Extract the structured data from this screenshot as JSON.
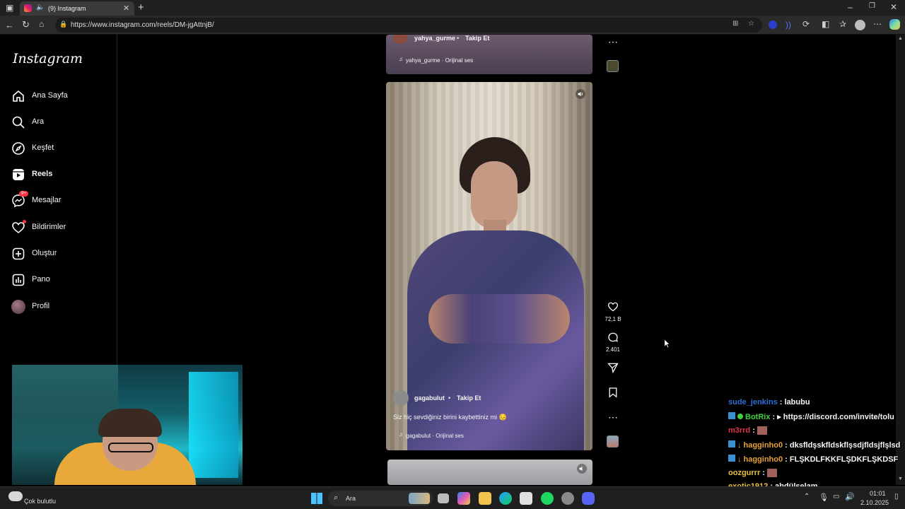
{
  "browser": {
    "tab_title": "(9) Instagram",
    "new_tab": "+",
    "url": "https://www.instagram.com/reels/DM-jgAttnjB/"
  },
  "instagram": {
    "logo": "Instagram",
    "nav": [
      {
        "label": "Ana Sayfa",
        "icon": "home-icon"
      },
      {
        "label": "Ara",
        "icon": "search-icon"
      },
      {
        "label": "Keşfet",
        "icon": "compass-icon"
      },
      {
        "label": "Reels",
        "icon": "reels-icon"
      },
      {
        "label": "Mesajlar",
        "icon": "messenger-icon",
        "badge": "9+"
      },
      {
        "label": "Bildirimler",
        "icon": "heart-icon"
      },
      {
        "label": "Oluştur",
        "icon": "plus-square-icon"
      },
      {
        "label": "Pano",
        "icon": "dashboard-icon"
      },
      {
        "label": "Profil",
        "icon": "avatar-icon"
      }
    ],
    "reel_top": {
      "username": "yahya_gurme",
      "follow": "Takip Et",
      "audio": "yahya_gurme · Orijinal ses"
    },
    "reel_main": {
      "username": "gagabulut",
      "follow": "Takip Et",
      "caption": "Siz hiç sevdiğiniz birini kaybettiniz mi 😔",
      "audio": "gagabulut · Orijinal ses",
      "likes": "72,1 B",
      "comments": "2.401"
    }
  },
  "chat": [
    {
      "user": "sude_jenkins",
      "msg": "labubu",
      "color": "#2f6fd6"
    },
    {
      "user": "BotRix",
      "msg": "▸ https://discord.com/invite/tolu",
      "color": "#3fd23f"
    },
    {
      "user": "m3rrd",
      "msg": "",
      "color": "#e0334a"
    },
    {
      "user": "hagginho0",
      "msg": "dksfldşskfldskflşsdjfldsjflşlsd",
      "color": "#e6a23a"
    },
    {
      "user": "hagginho0",
      "msg": "FLŞKDLFKKFLŞDKFLŞKDSF",
      "color": "#e6a23a"
    },
    {
      "user": "oozgurrr",
      "msg": "",
      "color": "#e6c23a"
    },
    {
      "user": "exotic1912",
      "msg": "abdülselam",
      "color": "#e6c23a"
    }
  ],
  "taskbar": {
    "weather": "Çok bulutlu",
    "search": "Ara",
    "time": "01:01",
    "date": "2.10.2025"
  },
  "colors": {
    "ig_bg": "#000000",
    "badge": "#ff3040",
    "link": "#0095f6"
  }
}
